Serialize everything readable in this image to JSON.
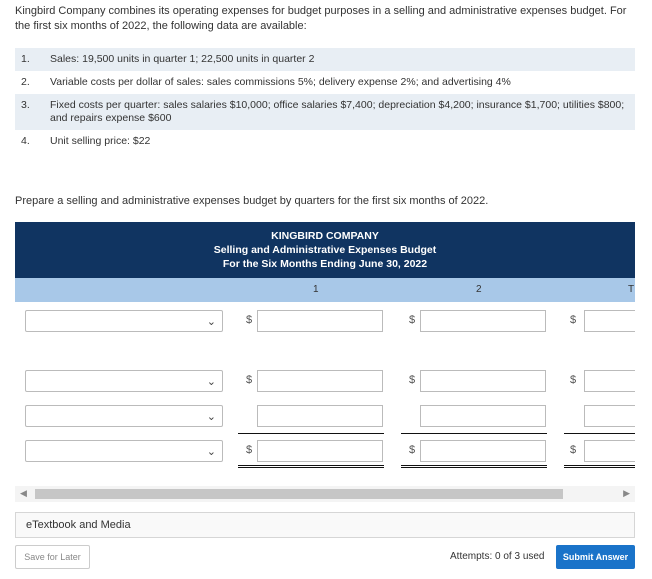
{
  "intro": "Kingbird Company combines its operating expenses for budget purposes in a selling and administrative expenses budget. For the first six months of 2022, the following data are available:",
  "facts": [
    {
      "num": "1.",
      "text": "Sales: 19,500 units in quarter 1; 22,500 units in quarter 2"
    },
    {
      "num": "2.",
      "text": "Variable costs per dollar of sales: sales commissions 5%; delivery expense 2%; and advertising 4%"
    },
    {
      "num": "3.",
      "text": "Fixed costs per quarter: sales salaries $10,000; office salaries $7,400; depreciation $4,200; insurance $1,700; utilities $800; and repairs expense $600"
    },
    {
      "num": "4.",
      "text": "Unit selling price: $22"
    }
  ],
  "prompt": "Prepare a selling and administrative expenses budget by quarters for the first six months of 2022.",
  "budget": {
    "company": "KINGBIRD COMPANY",
    "title": "Selling and Administrative Expenses Budget",
    "period": "For the Six Months Ending June 30, 2022",
    "col1": "1",
    "col2": "2",
    "col3": "T",
    "dollar": "$"
  },
  "etextbook": "eTextbook and Media",
  "save_label": "Save for Later",
  "attempts": "Attempts: 0 of 3 used",
  "submit_label": "Submit Answer",
  "colors": {
    "header_bg": "#103461",
    "subheader_bg": "#a8c8e8",
    "submit_bg": "#1a73c9",
    "stripe": "#e8eef4"
  },
  "icons": {
    "dropdown": "chevron-down-icon",
    "scroll_left": "triangle-left-icon",
    "scroll_right": "triangle-right-icon"
  }
}
